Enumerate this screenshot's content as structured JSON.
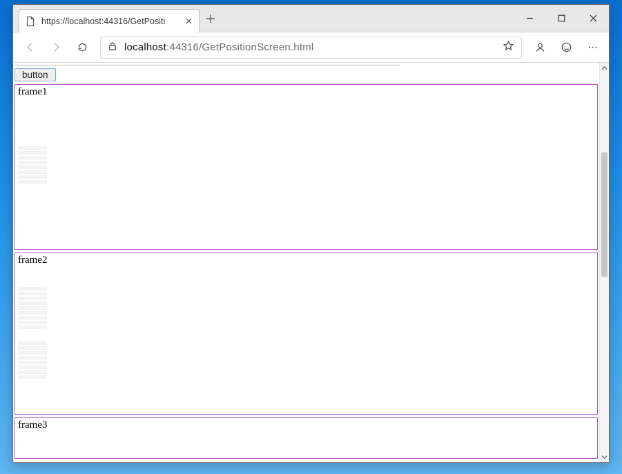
{
  "browser": {
    "tab_title": "https://localhost:44316/GetPositi",
    "new_tab_tooltip": "New tab",
    "window": {
      "minimize": "Minimize",
      "maximize": "Maximize",
      "close": "Close"
    }
  },
  "toolbar": {
    "back": "Back",
    "forward": "Forward",
    "refresh": "Refresh",
    "url_host": "localhost",
    "url_port_path": ":44316/GetPositionScreen.html",
    "favorite": "Add to favorites",
    "profile": "Profile",
    "feedback": "Feedback",
    "more": "Settings and more"
  },
  "page": {
    "button_label": "button",
    "frames": [
      {
        "label": "frame1"
      },
      {
        "label": "frame2"
      },
      {
        "label": "frame3"
      }
    ]
  },
  "scrollbar": {
    "scroll_up": "Scroll up",
    "scroll_down": "Scroll down"
  }
}
